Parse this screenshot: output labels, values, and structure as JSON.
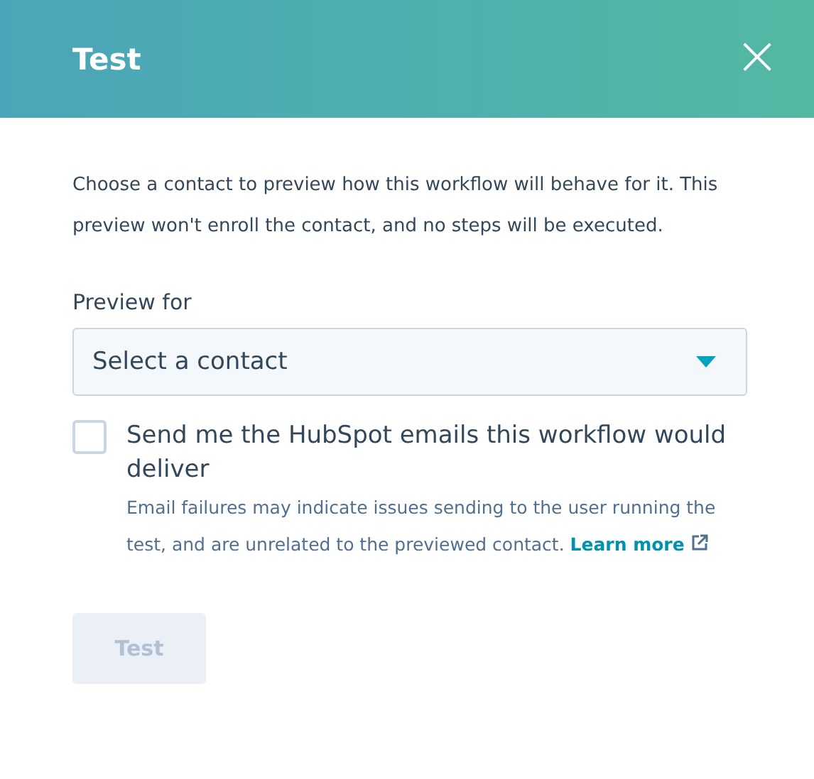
{
  "dialog": {
    "title": "Test",
    "close_icon": "×"
  },
  "description": "Choose a contact to preview how this workflow will behave for it. This preview won't enroll the contact, and no steps will be executed.",
  "preview_field": {
    "label": "Preview for",
    "placeholder": "Select a contact"
  },
  "email_option": {
    "label": "Send me the HubSpot emails this workflow would deliver",
    "checked": false,
    "help": "Email failures may indicate issues sending to the user running the test, and are unrelated to the previewed contact.",
    "link": "Learn more"
  },
  "test_button": {
    "label": "Test",
    "disabled": true
  }
}
